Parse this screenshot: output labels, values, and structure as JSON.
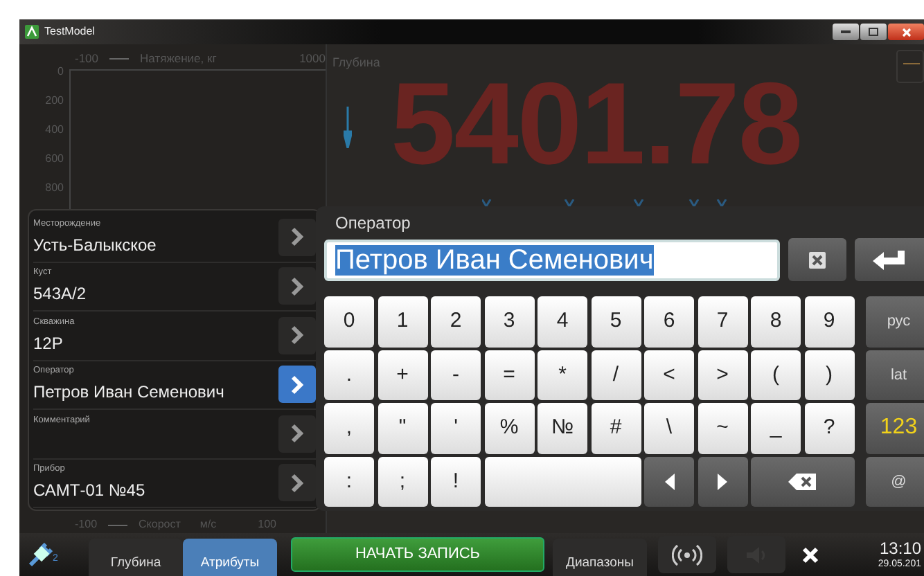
{
  "window": {
    "title": "TestModel"
  },
  "tension_chart": {
    "axis_min": "-100",
    "legend": "Натяжение, кг",
    "axis_max": "1000",
    "y_ticks": [
      "0",
      "200",
      "400",
      "600",
      "800"
    ]
  },
  "depth": {
    "label": "Глубина",
    "value": "5401.78"
  },
  "speed_axis": {
    "axis_min": "-100",
    "legend_parts": [
      "Скорост",
      "м/с"
    ],
    "axis_max": "100"
  },
  "attributes": [
    {
      "label": "Месторождение",
      "value": "Усть-Балыкское",
      "selected": false
    },
    {
      "label": "Куст",
      "value": "543А/2",
      "selected": false
    },
    {
      "label": "Скважина",
      "value": "12Р",
      "selected": false
    },
    {
      "label": "Оператор",
      "value": "Петров Иван Семенович",
      "selected": true
    },
    {
      "label": "Комментарий",
      "selected": false
    },
    {
      "label": "Прибор",
      "value": "САМТ-01 №45",
      "selected": false
    }
  ],
  "editor": {
    "label": "Оператор",
    "value": "Петров Иван Семенович",
    "text_selected": true
  },
  "keys": [
    [
      {
        "kind": "char",
        "label": "0"
      },
      {
        "kind": "char",
        "label": "1"
      },
      {
        "kind": "char",
        "label": "2"
      },
      {
        "kind": "char",
        "label": "3"
      },
      {
        "kind": "char",
        "label": "4"
      },
      {
        "kind": "char",
        "label": "5"
      },
      {
        "kind": "char",
        "label": "6"
      },
      {
        "kind": "char",
        "label": "7"
      },
      {
        "kind": "char",
        "label": "8"
      },
      {
        "kind": "char",
        "label": "9"
      }
    ],
    [
      {
        "kind": "char",
        "label": "."
      },
      {
        "kind": "char",
        "label": "+"
      },
      {
        "kind": "char",
        "label": "-"
      },
      {
        "kind": "char",
        "label": "="
      },
      {
        "kind": "char",
        "label": "*"
      },
      {
        "kind": "char",
        "label": "/"
      },
      {
        "kind": "char",
        "label": "<"
      },
      {
        "kind": "char",
        "label": ">"
      },
      {
        "kind": "char",
        "label": "("
      },
      {
        "kind": "char",
        "label": ")"
      }
    ],
    [
      {
        "kind": "char",
        "label": ","
      },
      {
        "kind": "char",
        "label": "\""
      },
      {
        "kind": "char",
        "label": "'"
      },
      {
        "kind": "char",
        "label": "%"
      },
      {
        "kind": "char",
        "label": "№"
      },
      {
        "kind": "char",
        "label": "#"
      },
      {
        "kind": "char",
        "label": "\\"
      },
      {
        "kind": "char",
        "label": "~"
      },
      {
        "kind": "char",
        "label": "_"
      },
      {
        "kind": "char",
        "label": "?"
      }
    ],
    [
      {
        "kind": "char",
        "label": ":"
      },
      {
        "kind": "char",
        "label": ";"
      },
      {
        "kind": "char",
        "label": "!"
      },
      {
        "kind": "space"
      },
      {
        "kind": "left"
      },
      {
        "kind": "right"
      },
      {
        "kind": "backspace"
      }
    ]
  ],
  "side_keys": [
    {
      "label": "рус",
      "selected": false
    },
    {
      "label": "lat",
      "selected": false
    },
    {
      "label": "123",
      "selected": true
    },
    {
      "label": "@",
      "selected": false
    }
  ],
  "toolbar": {
    "connection_count": "2",
    "tabs": [
      {
        "label": "Глубина",
        "selected": false
      },
      {
        "label": "Атрибуты",
        "selected": true
      }
    ],
    "record_button": "НАЧАТЬ ЗАПИСЬ",
    "ranges_button": "Диапазоны",
    "sound_enabled": false,
    "time": "13:10",
    "date": "29.05.201"
  }
}
